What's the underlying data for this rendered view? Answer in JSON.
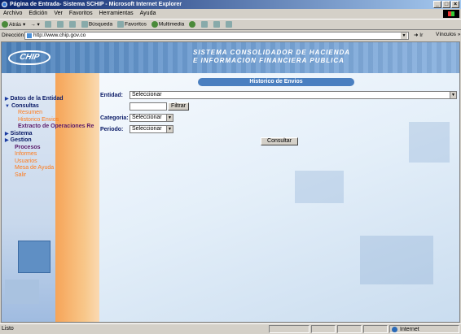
{
  "window": {
    "title": "Página de Entrada- Sistema SCHIP - Microsoft Internet Explorer"
  },
  "menu": [
    "Archivo",
    "Edición",
    "Ver",
    "Favoritos",
    "Herramientas",
    "Ayuda"
  ],
  "toolbar": {
    "back": "Atrás",
    "search": "Búsqueda",
    "favorites": "Favoritos",
    "media": "Multimedia"
  },
  "address": {
    "label": "Dirección",
    "url": "http://www.chip.gov.co",
    "go": "Ir",
    "links": "Vínculos"
  },
  "banner": {
    "logo": "CHIP",
    "line1": "SISTEMA CONSOLIDADOR DE HACIENDA",
    "line2": "E INFORMACION FINANCIERA PUBLICA"
  },
  "nav": {
    "datos": "Datos de la Entidad",
    "consultas": "Consultas",
    "sub": [
      "Resumen",
      "Historico Envios",
      "Extracto de Operaciones Re"
    ],
    "sistema": "Sistema",
    "gestion": "Gestion",
    "links": [
      "Procesos",
      "Informes",
      "Usuarios",
      "Mesa de Ayuda",
      "Salir"
    ]
  },
  "form": {
    "title": "Historico de Envios",
    "entidad_label": "Entidad:",
    "entidad_value": "Seleccionar",
    "filter_button": "Filtrar",
    "categoria_label": "Categoria:",
    "categoria_value": "Seleccionar",
    "periodo_label": "Periodo:",
    "periodo_value": "Seleccionar",
    "consult_button": "Consultar"
  },
  "status": {
    "left": "Listo",
    "zone": "Internet"
  }
}
